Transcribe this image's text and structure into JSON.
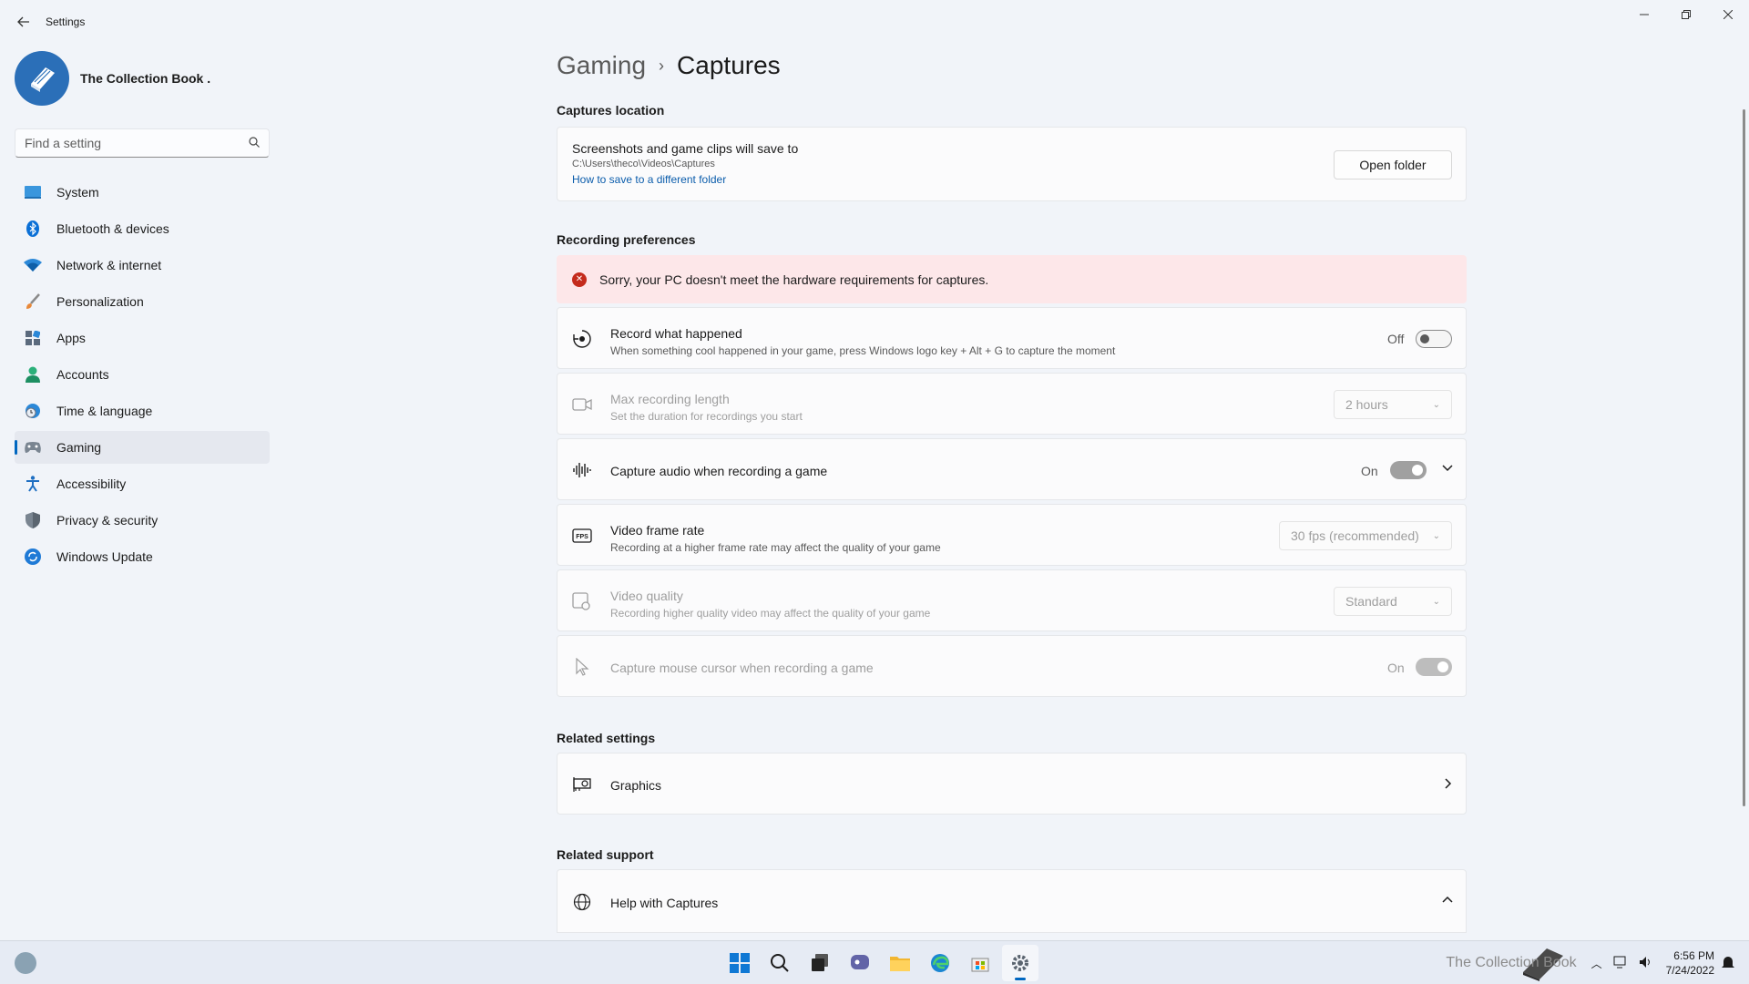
{
  "window": {
    "title": "Settings",
    "back_icon": "back-arrow-icon",
    "controls": [
      "minimize",
      "restore",
      "close"
    ]
  },
  "profile": {
    "name": "The Collection Book ."
  },
  "search": {
    "placeholder": "Find a setting"
  },
  "nav": {
    "items": [
      {
        "label": "System",
        "icon": "monitor-icon"
      },
      {
        "label": "Bluetooth & devices",
        "icon": "bluetooth-icon"
      },
      {
        "label": "Network & internet",
        "icon": "wifi-icon"
      },
      {
        "label": "Personalization",
        "icon": "brush-icon"
      },
      {
        "label": "Apps",
        "icon": "apps-icon"
      },
      {
        "label": "Accounts",
        "icon": "person-icon"
      },
      {
        "label": "Time & language",
        "icon": "globe-clock-icon"
      },
      {
        "label": "Gaming",
        "icon": "gamepad-icon",
        "active": true
      },
      {
        "label": "Accessibility",
        "icon": "accessibility-icon"
      },
      {
        "label": "Privacy & security",
        "icon": "shield-icon"
      },
      {
        "label": "Windows Update",
        "icon": "update-icon"
      }
    ]
  },
  "breadcrumb": {
    "parent": "Gaming",
    "separator": "›",
    "current": "Captures"
  },
  "captures_location": {
    "section_title": "Captures location",
    "title": "Screenshots and game clips will save to",
    "path": "C:\\Users\\theco\\Videos\\Captures",
    "link": "How to save to a different folder",
    "button": "Open folder"
  },
  "recording": {
    "section_title": "Recording preferences",
    "error": "Sorry, your PC doesn't meet the hardware requirements for captures.",
    "record_what_happened": {
      "title": "Record what happened",
      "sub": "When something cool happened in your game, press Windows logo key + Alt + G to capture the moment",
      "state": "Off"
    },
    "max_length": {
      "title": "Max recording length",
      "sub": "Set the duration for recordings you start",
      "value": "2 hours"
    },
    "capture_audio": {
      "title": "Capture audio when recording a game",
      "state": "On"
    },
    "frame_rate": {
      "title": "Video frame rate",
      "sub": "Recording at a higher frame rate may affect the quality of your game",
      "value": "30 fps (recommended)"
    },
    "video_quality": {
      "title": "Video quality",
      "sub": "Recording higher quality video may affect the quality of your game",
      "value": "Standard"
    },
    "mouse_cursor": {
      "title": "Capture mouse cursor when recording a game",
      "state": "On"
    }
  },
  "related_settings": {
    "section_title": "Related settings",
    "graphics": "Graphics"
  },
  "related_support": {
    "section_title": "Related support",
    "help": "Help with Captures"
  },
  "taskbar": {
    "icons": [
      "start-icon",
      "search-icon",
      "task-view-icon",
      "chat-icon",
      "file-explorer-icon",
      "edge-icon",
      "store-icon",
      "settings-icon"
    ],
    "watermark": "The Collection Book",
    "time": "6:56 PM",
    "date": "7/24/2022"
  },
  "colors": {
    "accent": "#0067c0",
    "error_bg": "#fde7e9",
    "error_icon": "#c42b1c"
  }
}
